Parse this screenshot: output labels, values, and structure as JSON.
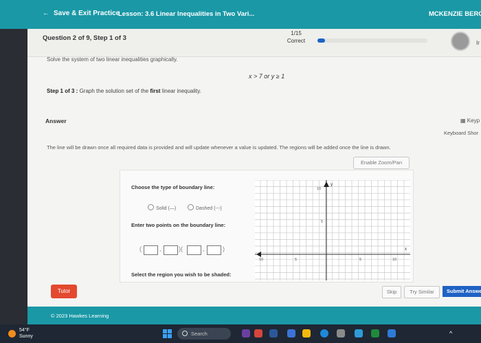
{
  "topbar": {
    "back_label": "Save & Exit Practice",
    "lesson": "Lesson: 3.6 Linear Inequalities in Two Vari...",
    "user": "MCKENZIE BERCIER"
  },
  "question": {
    "number": "Question 2 of 9,",
    "step": "Step 1 of 3",
    "score_fraction": "1/15",
    "score_status": "Correct",
    "progress": 0.07,
    "cut_text": "Ir"
  },
  "problem": {
    "instruction": "Solve the system of two linear inequalities graphically.",
    "system": "x > 7 or y ≥ 1",
    "step_prefix": "Step 1 of 3 :",
    "step_text_a": "Graph the solution set of the",
    "step_text_bold": "first",
    "step_text_b": "linear inequality."
  },
  "answer": {
    "label": "Answer",
    "keypad": "Keyp",
    "keyboard": "Keyboard Shor",
    "info": "The line will be drawn once all required data is provided and will update whenever a value is updated. The regions will be added once the line is drawn.",
    "zoom_button": "Enable Zoom/Pan",
    "boundary_title": "Choose the type of boundary line:",
    "solid_label": "Solid (—)",
    "dashed_label": "Dashed (---)",
    "points_title": "Enter two points on the boundary line:",
    "open_paren": "(",
    "comma": ",",
    "mid_paren": ")(",
    "close_paren": ")",
    "region_title": "Select the region you wish to be shaded:"
  },
  "graph": {
    "y_label": "y",
    "x_label": "x",
    "ticks": {
      "top": "10",
      "mid_y": "5",
      "left": "10",
      "mid_x_neg": "5",
      "mid_x_pos": "5",
      "right": "10"
    }
  },
  "buttons": {
    "tutor": "Tutor",
    "skip": "Skip",
    "try_similar": "Try Similar",
    "submit": "Submit Answe"
  },
  "footer": {
    "copyright": "© 2023 Hawkes Learning"
  },
  "taskbar": {
    "temp": "54°F",
    "weather": "Sunny",
    "search_placeholder": "Search"
  },
  "colors": {
    "brand": "#1a98a6",
    "submit": "#1e62c4",
    "tutor": "#e3492f"
  }
}
